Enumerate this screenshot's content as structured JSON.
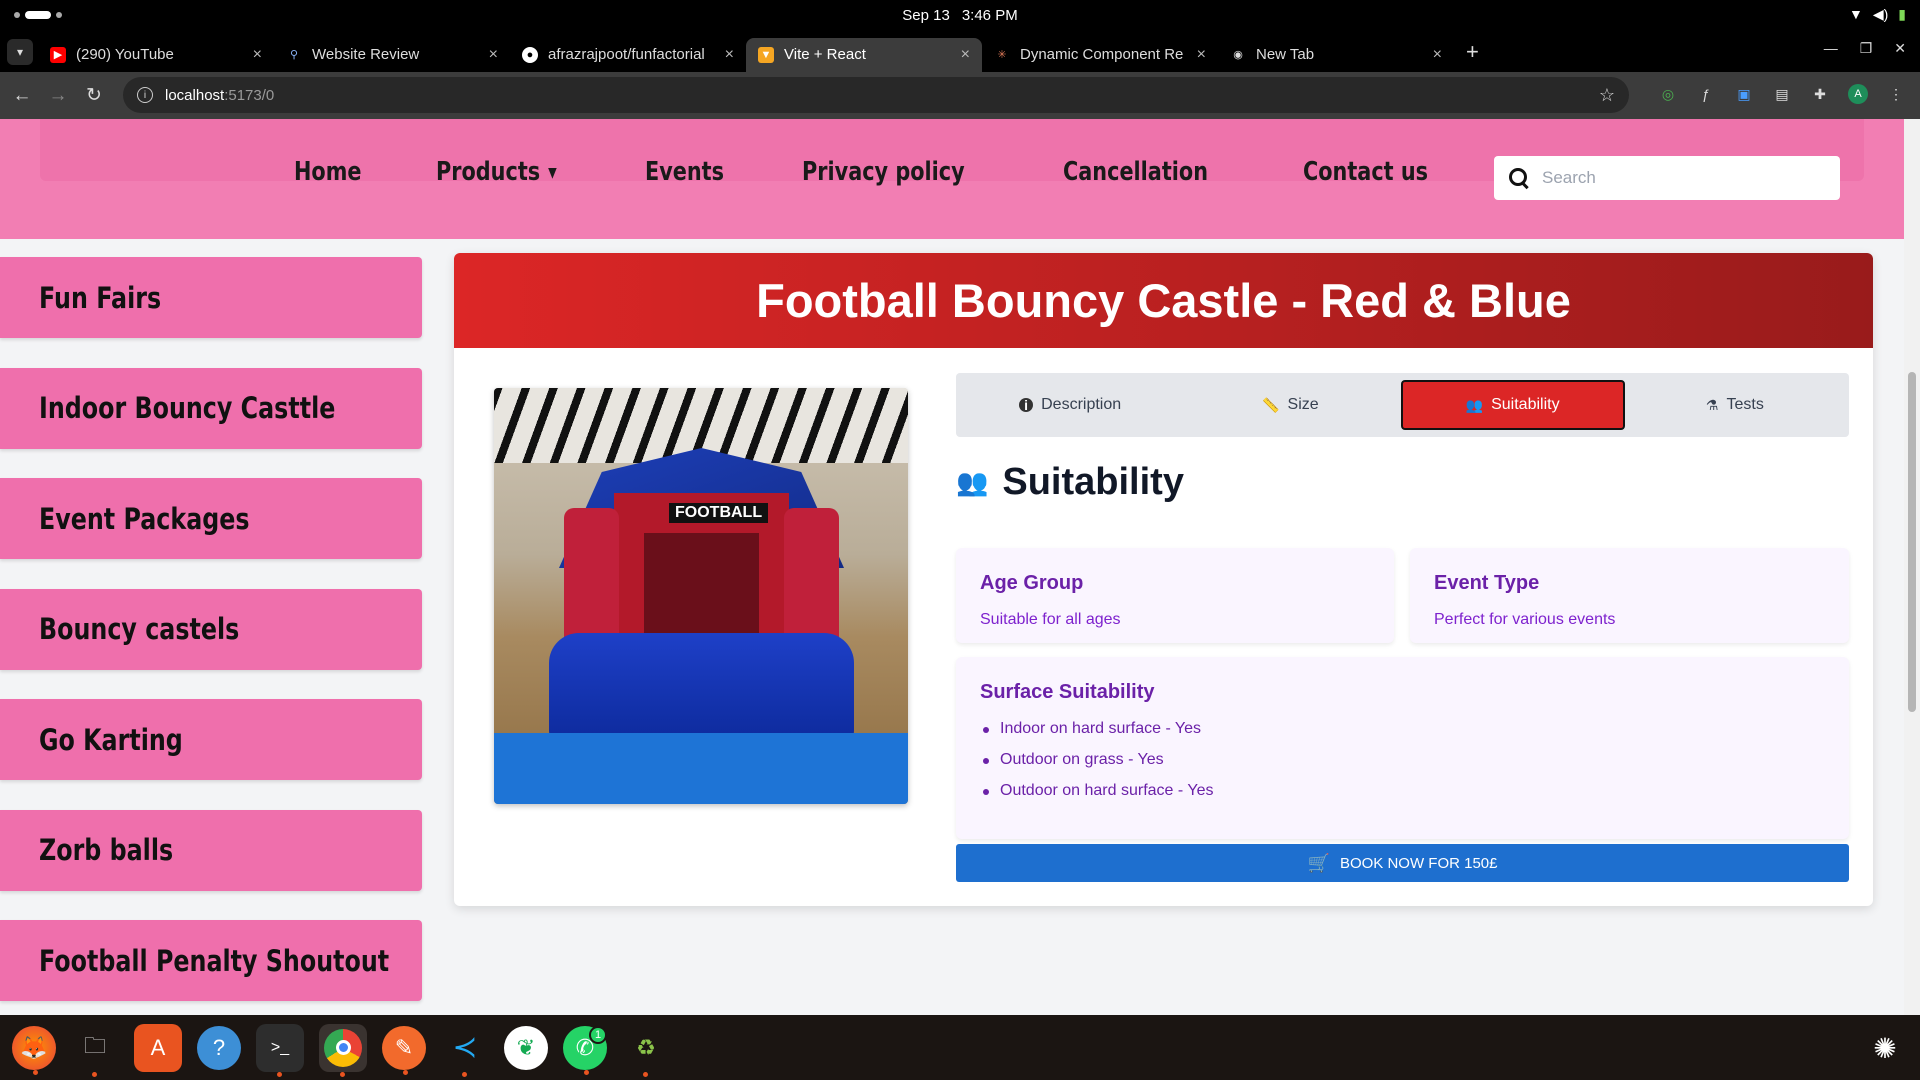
{
  "system": {
    "date": "Sep 13",
    "time": "3:46 PM"
  },
  "browser": {
    "tabs": [
      {
        "title": "(290) YouTube",
        "favicon": "youtube-icon",
        "color": "#ff0000"
      },
      {
        "title": "Website Review",
        "favicon": "search-icon",
        "color": "#4285f4"
      },
      {
        "title": "afrazrajpoot/funfactorial",
        "favicon": "github-icon",
        "color": "#ffffff"
      },
      {
        "title": "Vite + React",
        "favicon": "vite-icon",
        "color": "#f5a623",
        "active": true
      },
      {
        "title": "Dynamic Component Re",
        "favicon": "claude-icon",
        "color": "#d97757"
      },
      {
        "title": "New Tab",
        "favicon": "chrome-icon",
        "color": "#dddddd"
      }
    ],
    "url_host": "localhost",
    "url_path": ":5173/0"
  },
  "site": {
    "nav": {
      "home": "Home",
      "products": "Products",
      "events": "Events",
      "privacy": "Privacy policy",
      "cancellation": "Cancellation",
      "contact": "Contact us"
    },
    "search_placeholder": "Search",
    "sidebar": [
      "Fun Fairs",
      "Indoor Bouncy Casttle",
      "Event Packages",
      "Bouncy castels",
      "Go Karting",
      "Zorb balls",
      "Football Penalty Shoutout"
    ]
  },
  "product": {
    "title": "Football Bouncy Castle - Red & Blue",
    "image_sign": "FOOTBALL",
    "tabs": {
      "description": "Description",
      "size": "Size",
      "suitability": "Suitability",
      "tests": "Tests"
    },
    "section_title": "Suitability",
    "age_group": {
      "title": "Age Group",
      "text": "Suitable for all ages"
    },
    "event_type": {
      "title": "Event Type",
      "text": "Perfect for various events"
    },
    "surface": {
      "title": "Surface Suitability",
      "items": [
        "Indoor on hard surface - Yes",
        "Outdoor on grass - Yes",
        "Outdoor on hard surface - Yes"
      ]
    },
    "book_label": "BOOK NOW FOR 150£"
  },
  "colors": {
    "header_pink": "#f27eb3",
    "sidebar_pink": "#ef6fac",
    "title_red": "#dc2626",
    "book_blue": "#1e6fcf",
    "accent_purple": "#7c3aed"
  },
  "dock": {
    "whatsapp_badge": "1"
  }
}
